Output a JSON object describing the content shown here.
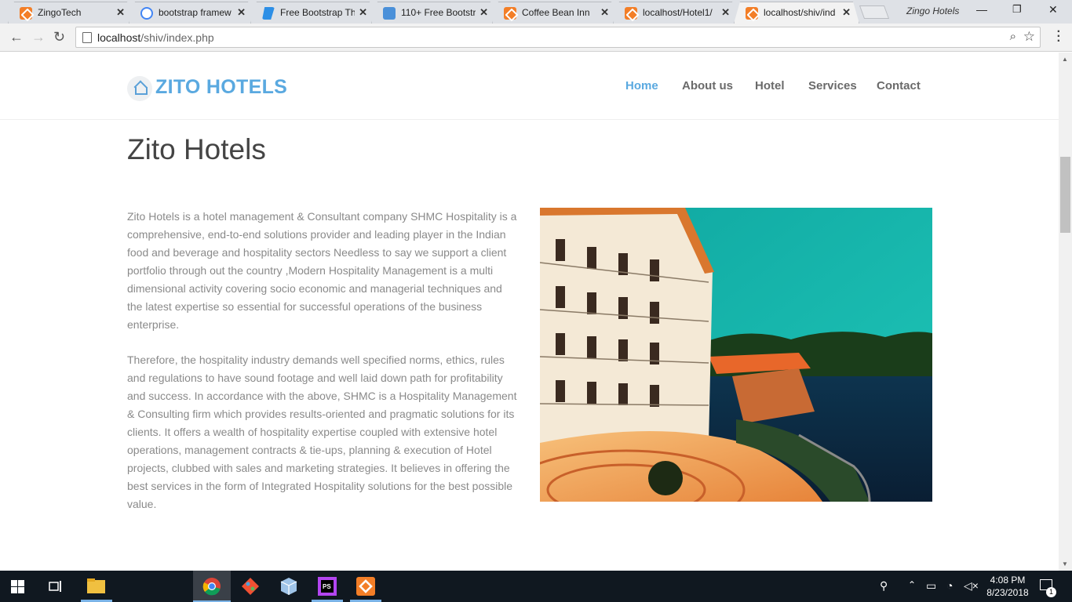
{
  "browser": {
    "tabs": [
      {
        "title": "ZingoTech",
        "favicon": "xampp-icon"
      },
      {
        "title": "bootstrap framew",
        "favicon": "google-icon"
      },
      {
        "title": "Free Bootstrap Th",
        "favicon": "bootstrap-icon"
      },
      {
        "title": "110+ Free Bootstr",
        "favicon": "file-icon"
      },
      {
        "title": "Coffee Bean Inn",
        "favicon": "xampp-icon"
      },
      {
        "title": "localhost/Hotel1/",
        "favicon": "xampp-icon"
      },
      {
        "title": "localhost/shiv/ind",
        "favicon": "xampp-icon",
        "active": true
      }
    ],
    "profile_name": "Zingo Hotels",
    "url_host": "localhost",
    "url_path": "/shiv/index.php"
  },
  "site": {
    "brand": "ZITO HOTELS",
    "nav": [
      "Home",
      "About us",
      "Hotel",
      "Services",
      "Contact"
    ],
    "active_nav": "Home",
    "accent_color": "#5aa9e0",
    "page_title": "Zito Hotels",
    "paragraphs": [
      "Zito Hotels is a hotel management & Consultant company SHMC Hospitality is a comprehensive, end-to-end solutions provider and leading player in the Indian food and beverage and hospitality sectors Needless to say we support a client portfolio through out the country ,Modern Hospitality Management is a multi dimensional activity covering socio economic and managerial techniques and the latest expertise so essential for successful operations of the business enterprise.",
      "Therefore, the hospitality industry demands well specified norms, ethics, rules and regulations to have sound footage and well laid down path for profitability and success. In accordance with the above, SHMC is a Hospitality Management & Consulting firm which provides results-oriented and pragmatic solutions for its clients. It offers a wealth of hospitality expertise coupled with extensive hotel operations, management contracts & tie-ups, planning & execution of Hotel projects, clubbed with sales and marketing strategies. It believes in offering the best services in the form of Integrated Hospitality solutions for the best possible value."
    ]
  },
  "taskbar": {
    "time": "4:08 PM",
    "date": "8/23/2018",
    "notification_count": "1"
  }
}
